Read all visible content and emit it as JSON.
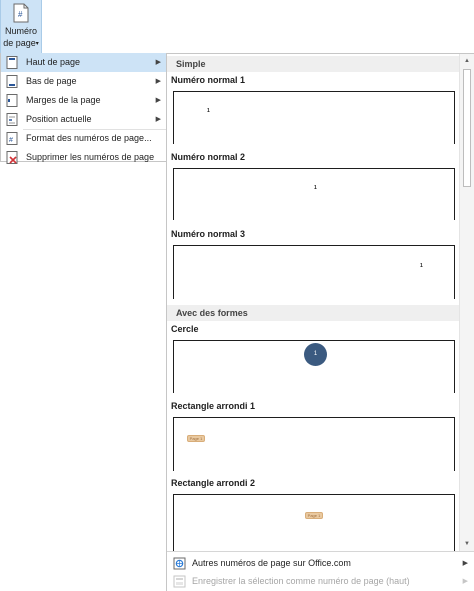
{
  "ribbon": {
    "button_line1": "Numéro",
    "button_line2": "de page",
    "button_icon": "page-number-icon",
    "button_caret": "▾"
  },
  "menu": {
    "items": [
      {
        "label": "Haut de page",
        "icon": "page-header-icon",
        "has_submenu": true,
        "active": true
      },
      {
        "label": "Bas de page",
        "icon": "page-footer-icon",
        "has_submenu": true,
        "active": false
      },
      {
        "label": "Marges de la page",
        "icon": "page-margins-icon",
        "has_submenu": true,
        "active": false
      },
      {
        "label": "Position actuelle",
        "icon": "current-position-icon",
        "has_submenu": true,
        "active": false
      },
      {
        "label": "Format des numéros de page...",
        "icon": "format-page-number-icon",
        "has_submenu": false,
        "active": false
      },
      {
        "label": "Supprimer les numéros de page",
        "icon": "remove-page-number-icon",
        "has_submenu": false,
        "active": false
      }
    ],
    "submenu_arrow": "▶"
  },
  "gallery": {
    "sections": [
      {
        "header": "Simple"
      },
      {
        "header": "Avec des formes"
      }
    ],
    "items": [
      {
        "title": "Numéro normal 1",
        "number": "1"
      },
      {
        "title": "Numéro normal 2",
        "number": "1"
      },
      {
        "title": "Numéro normal 3",
        "number": "1"
      },
      {
        "title": "Cercle",
        "number": "1"
      },
      {
        "title": "Rectangle arrondi 1",
        "number": "Page 1"
      },
      {
        "title": "Rectangle arrondi 2",
        "number": "Page 1"
      }
    ],
    "scroll_up": "▲",
    "scroll_down": "▼"
  },
  "bottom": {
    "more_label": "Autres numéros de page sur Office.com",
    "more_icon": "office-com-icon",
    "save_label": "Enregistrer la sélection comme numéro de page (haut)",
    "save_icon": "save-selection-icon",
    "arrow": "▶"
  },
  "colors": {
    "active_bg": "#cde3f6",
    "circle_fill": "#3b5a80",
    "rounded_rect_fill": "#e9c9a0",
    "disabled_text": "#a6a6a6"
  }
}
